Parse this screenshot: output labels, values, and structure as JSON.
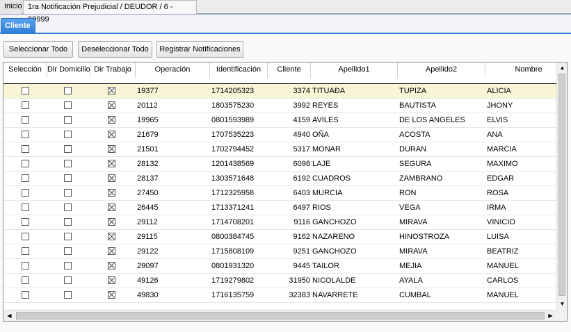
{
  "tabs": {
    "home": "Inicio",
    "active": "1ra Notificación Prejudicial / DEUDOR / 6 - 99999"
  },
  "subtab": "Cliente",
  "toolbar": {
    "select_all": "Seleccionar Todo",
    "deselect_all": "Deseleccionar Todo",
    "register": "Registrar Notificaciones"
  },
  "columns": [
    "Selección",
    "Dir Domicilio",
    "Dir Trabajo",
    "Operación",
    "Identificación",
    "Cliente",
    "Apellido1",
    "Apellido2",
    "Nombre"
  ],
  "rows": [
    {
      "seleccion": false,
      "dir_domicilio": false,
      "dir_trabajo": true,
      "operacion": "19377",
      "identificacion": "1714205323",
      "cliente": "3374",
      "apellido1": "TITUAÐA",
      "apellido2": "TUPIZA",
      "nombre": "ALICIA"
    },
    {
      "seleccion": false,
      "dir_domicilio": false,
      "dir_trabajo": true,
      "operacion": "20112",
      "identificacion": "1803575230",
      "cliente": "3992",
      "apellido1": "REYES",
      "apellido2": "BAUTISTA",
      "nombre": "JHONY"
    },
    {
      "seleccion": false,
      "dir_domicilio": false,
      "dir_trabajo": true,
      "operacion": "19965",
      "identificacion": "0801593989",
      "cliente": "4159",
      "apellido1": "AVILES",
      "apellido2": "DE LOS ANGELES",
      "nombre": "ELVIS"
    },
    {
      "seleccion": false,
      "dir_domicilio": false,
      "dir_trabajo": true,
      "operacion": "21679",
      "identificacion": "1707535223",
      "cliente": "4940",
      "apellido1": "OÑA",
      "apellido2": "ACOSTA",
      "nombre": "ANA"
    },
    {
      "seleccion": false,
      "dir_domicilio": false,
      "dir_trabajo": true,
      "operacion": "21501",
      "identificacion": "1702794452",
      "cliente": "5317",
      "apellido1": "MONAR",
      "apellido2": "DURAN",
      "nombre": "MARCIA"
    },
    {
      "seleccion": false,
      "dir_domicilio": false,
      "dir_trabajo": true,
      "operacion": "28132",
      "identificacion": "1201438569",
      "cliente": "6098",
      "apellido1": "LAJE",
      "apellido2": "SEGURA",
      "nombre": "MAXIMO"
    },
    {
      "seleccion": false,
      "dir_domicilio": false,
      "dir_trabajo": true,
      "operacion": "28137",
      "identificacion": "1303571648",
      "cliente": "6192",
      "apellido1": "CUADROS",
      "apellido2": "ZAMBRANO",
      "nombre": "EDGAR"
    },
    {
      "seleccion": false,
      "dir_domicilio": false,
      "dir_trabajo": true,
      "operacion": "27450",
      "identificacion": "1712325958",
      "cliente": "6403",
      "apellido1": "MURCIA",
      "apellido2": "RON",
      "nombre": "ROSA"
    },
    {
      "seleccion": false,
      "dir_domicilio": false,
      "dir_trabajo": true,
      "operacion": "26445",
      "identificacion": "1713371241",
      "cliente": "6497",
      "apellido1": "RIOS",
      "apellido2": "VEGA",
      "nombre": "IRMA"
    },
    {
      "seleccion": false,
      "dir_domicilio": false,
      "dir_trabajo": true,
      "operacion": "29112",
      "identificacion": "1714708201",
      "cliente": "9116",
      "apellido1": "GANCHOZO",
      "apellido2": "MIRAVA",
      "nombre": "VINICIO"
    },
    {
      "seleccion": false,
      "dir_domicilio": false,
      "dir_trabajo": true,
      "operacion": "29115",
      "identificacion": "0800384745",
      "cliente": "9162",
      "apellido1": "NAZARENO",
      "apellido2": "HINOSTROZA",
      "nombre": "LUISA"
    },
    {
      "seleccion": false,
      "dir_domicilio": false,
      "dir_trabajo": true,
      "operacion": "29122",
      "identificacion": "1715808109",
      "cliente": "9251",
      "apellido1": "GANCHOZO",
      "apellido2": "MIRAVA",
      "nombre": "BEATRIZ"
    },
    {
      "seleccion": false,
      "dir_domicilio": false,
      "dir_trabajo": true,
      "operacion": "29097",
      "identificacion": "0801931320",
      "cliente": "9445",
      "apellido1": "TAILOR",
      "apellido2": "MEJIA",
      "nombre": "MANUEL"
    },
    {
      "seleccion": false,
      "dir_domicilio": false,
      "dir_trabajo": true,
      "operacion": "49126",
      "identificacion": "1719279802",
      "cliente": "31950",
      "apellido1": "NICOLALDE",
      "apellido2": "AYALA",
      "nombre": "CARLOS"
    },
    {
      "seleccion": false,
      "dir_domicilio": false,
      "dir_trabajo": true,
      "operacion": "49830",
      "identificacion": "1716135759",
      "cliente": "32383",
      "apellido1": "NAVARRETE",
      "apellido2": "CUMBAL",
      "nombre": "MANUEL"
    }
  ],
  "icons": {
    "scroll_up": "arrow-up-icon",
    "scroll_down": "arrow-down-icon",
    "scroll_left": "arrow-left-icon",
    "scroll_right": "arrow-right-icon"
  },
  "colors": {
    "subtab_accent": "#2f7fd8",
    "selected_row": "#f7f5d6"
  }
}
